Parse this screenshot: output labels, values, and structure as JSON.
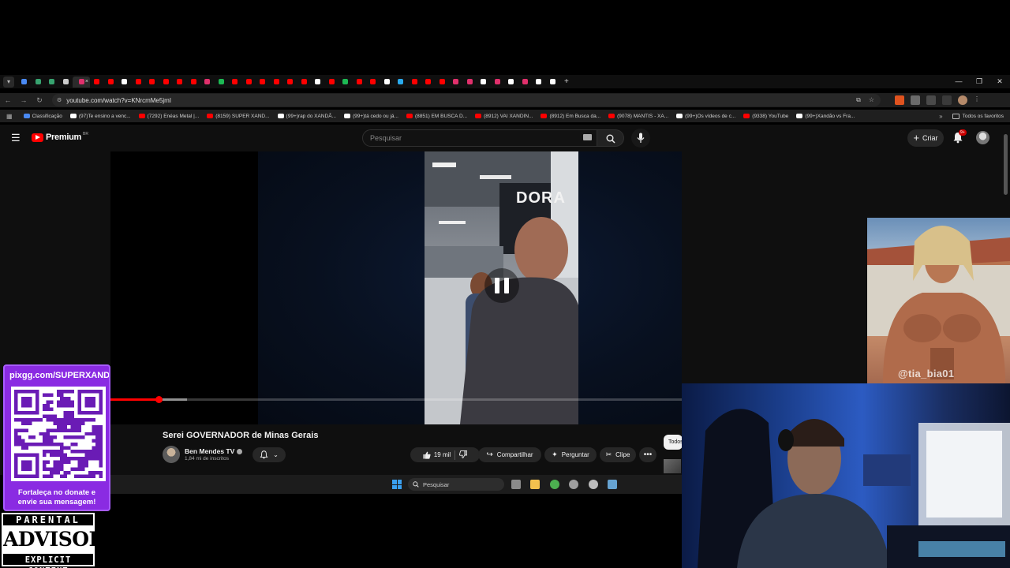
{
  "browser": {
    "tab_favicon_colors": [
      "#4a8af4",
      "#37a36f",
      "#37a36f",
      "#cccccc",
      "#e1306c",
      "#ff0000",
      "#ff0000",
      "#ffffff",
      "#ff0000",
      "#ff0000",
      "#ff0000",
      "#ff0000",
      "#ff0000",
      "#e1306c",
      "#1db954",
      "#ff0000",
      "#ff0000",
      "#ff0000",
      "#ff0000",
      "#ff0000",
      "#ff0000",
      "#ffffff",
      "#ff0000",
      "#1db954",
      "#ff0000",
      "#ff0000",
      "#ffffff",
      "#2aabee",
      "#ff0000",
      "#ff0000",
      "#ff0000",
      "#e1306c",
      "#e1306c",
      "#ffffff",
      "#e1306c",
      "#ffffff",
      "#e1306c",
      "#ffffff",
      "#ffffff"
    ],
    "active_tab_close": "×",
    "new_tab": "+",
    "url": "youtube.com/watch?v=KNrcmMe5jmI",
    "bookmarks": [
      {
        "label": "Classificação",
        "color": "#4a8af4"
      },
      {
        "label": "(97)Te ensino a venc...",
        "color": "#ffffff"
      },
      {
        "label": "(7292) Enéas Metal |...",
        "color": "#ff0000"
      },
      {
        "label": "(8159) SUPER XAND...",
        "color": "#ff0000"
      },
      {
        "label": "(99+)rap do XANDÃ...",
        "color": "#ffffff"
      },
      {
        "label": "(99+)tá cedo ou já...",
        "color": "#ffffff"
      },
      {
        "label": "(8851) EM BUSCA D...",
        "color": "#ff0000"
      },
      {
        "label": "(8912) VAI XANDIN...",
        "color": "#ff0000"
      },
      {
        "label": "(8912) Em Busca da...",
        "color": "#ff0000"
      },
      {
        "label": "(9078) MANTIS - XA...",
        "color": "#ff0000"
      },
      {
        "label": "(99+)Os vídeos de c...",
        "color": "#ffffff"
      },
      {
        "label": "(9338) YouTube",
        "color": "#ff0000"
      },
      {
        "label": "(99+)Xandão vs Fra...",
        "color": "#ffffff"
      }
    ],
    "bookmarks_more": "»",
    "all_bookmarks": "Todos os favoritos"
  },
  "youtube": {
    "logo_text": "Premium",
    "logo_country": "BR",
    "search_placeholder": "Pesquisar",
    "create_label": "Criar",
    "notifications_badge": "9+",
    "video": {
      "title": "Serei GOVERNADOR de Minas Gerais",
      "channel": "Ben Mendes TV",
      "subscribers": "1,84 mi de inscritos",
      "likes": "19 mil",
      "share_label": "Compartilhar",
      "ask_label": "Perguntar",
      "clip_label": "Clipe",
      "more_label": "•••",
      "progress_fraction": 0.085,
      "buffer_fraction": 0.134,
      "signage": "DORA"
    },
    "chip_all": "Todos"
  },
  "taskbar": {
    "search_label": "Pesquisar",
    "app_colors": [
      "#8a8a8a",
      "#f2c14e",
      "#4caf50",
      "#9e9e9e",
      "#bdbdbd",
      "#66a3d2"
    ]
  },
  "overlays": {
    "image_caption": "@tia_bia01",
    "donate_link": "pixgg.com/SUPERXANDAO",
    "donate_message_line1": "Fortaleça no donate e",
    "donate_message_line2": "envie sua mensagem!",
    "advisory_top": "PARENTAL",
    "advisory_mid": "ADVISORY",
    "advisory_bottom": "EXPLICIT CONTENT"
  }
}
